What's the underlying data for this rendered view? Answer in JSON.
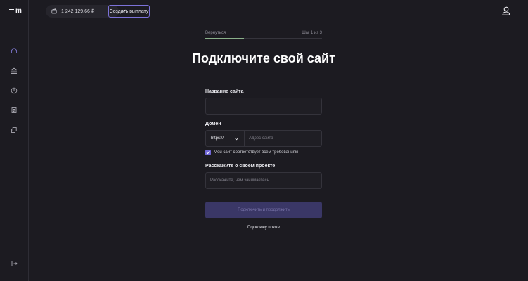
{
  "app": {
    "logo_text": "m",
    "balance": "1 242 129.66 ₽",
    "payout_button": "Создать выплату"
  },
  "sidebar": {
    "items": [
      {
        "icon": "home-icon"
      },
      {
        "icon": "bank-icon"
      },
      {
        "icon": "history-icon"
      },
      {
        "icon": "documents-icon"
      },
      {
        "icon": "copy-icon"
      }
    ],
    "bottom_icon": "logout-icon"
  },
  "wizard": {
    "back_label": "Вернуться",
    "step_label": "Шаг 1 из 3",
    "progress": 0.33,
    "title": "Подключите свой сайт",
    "site_name_label": "Название сайта",
    "site_name_value": "",
    "domain_label": "Домен",
    "protocol_value": "https://",
    "domain_placeholder": "Адрес сайта",
    "requirements_checkbox_label": "Мой сайт соответствует всем требованиям",
    "requirements_checked": true,
    "project_label": "Расскажите о своём проекте",
    "project_placeholder": "Расскажите, чем занимаетесь",
    "submit_button": "Подключить и продолжить",
    "later_link": "Подключу позже"
  },
  "colors": {
    "background": "#1c1b21",
    "accent": "#7c72d8",
    "progress": "#8ab08a"
  }
}
